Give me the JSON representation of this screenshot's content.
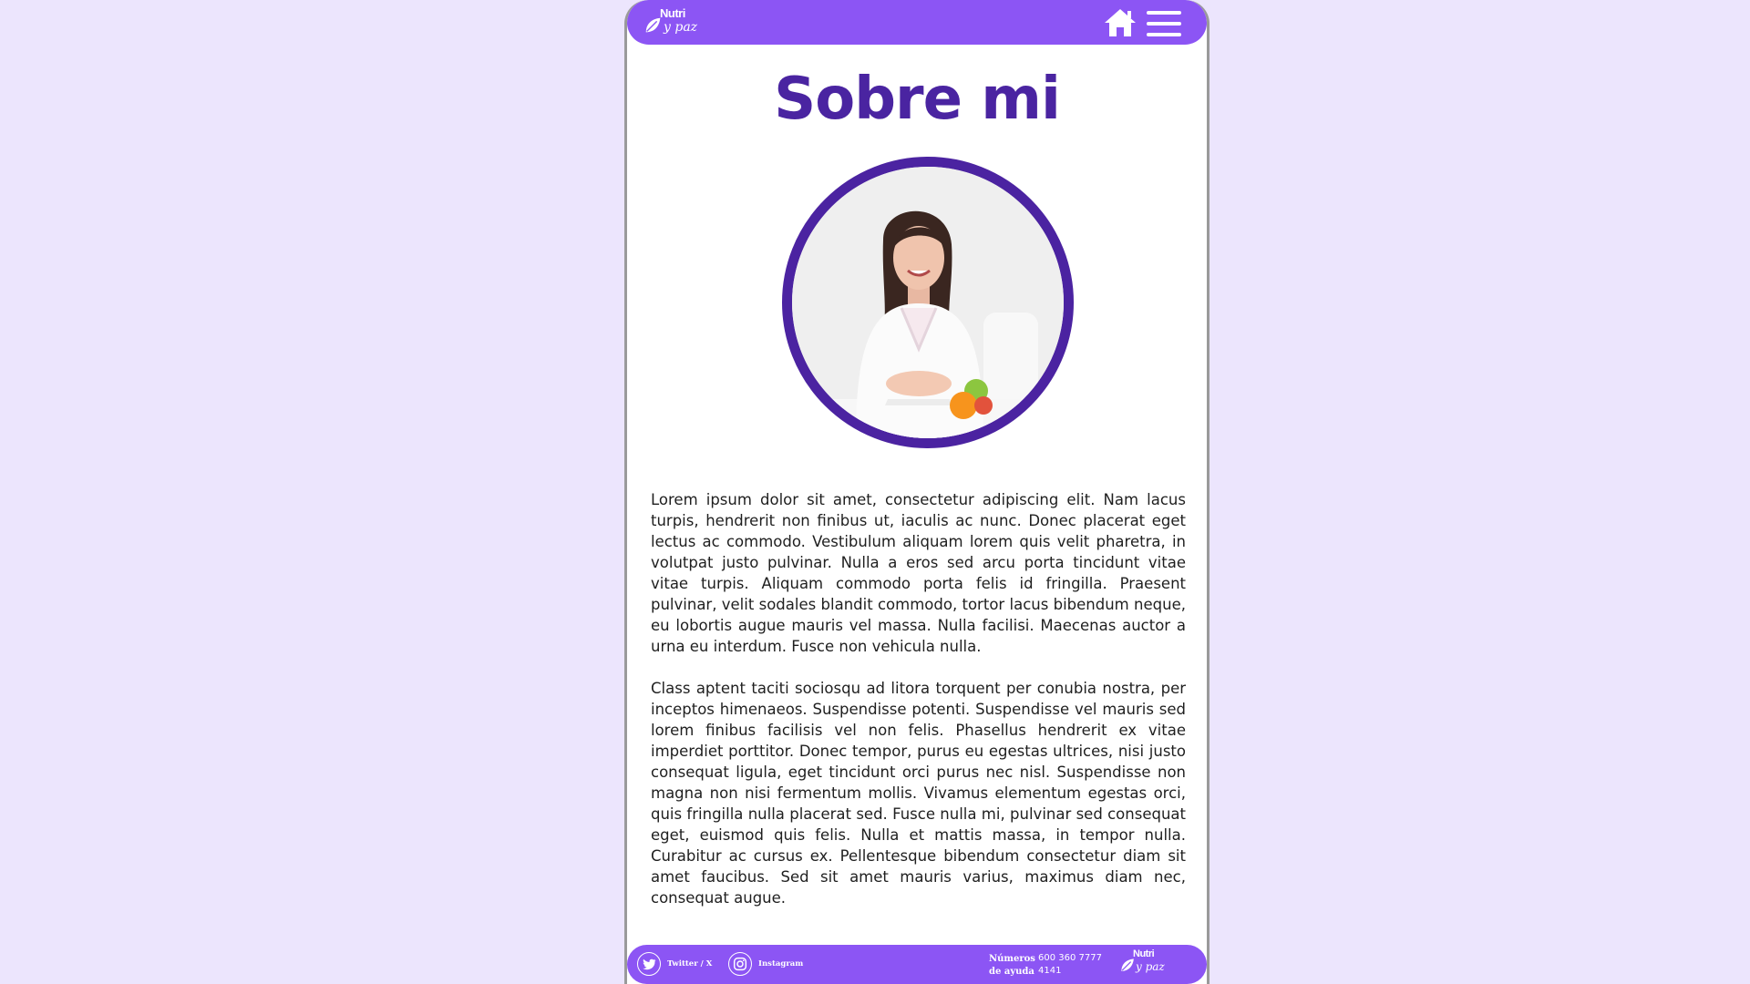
{
  "brand": {
    "line1": "Nutri",
    "line2": "y paz"
  },
  "header": {
    "home_icon": "home-icon",
    "menu_icon": "hamburger-menu-icon"
  },
  "page": {
    "title": "Sobre mi",
    "portrait_alt": "portrait-photo"
  },
  "content": {
    "paragraphs": [
      "Lorem ipsum dolor sit amet, consectetur adipiscing elit. Nam lacus turpis, hendrerit non finibus ut, iaculis ac nunc. Donec placerat eget lectus ac commodo. Vestibulum aliquam lorem quis velit pharetra, in volutpat justo pulvinar. Nulla a eros sed arcu porta tincidunt vitae vitae turpis. Aliquam commodo porta felis id fringilla. Praesent pulvinar, velit sodales blandit commodo, tortor lacus bibendum neque, eu lobortis augue mauris vel massa. Nulla facilisi. Maecenas auctor a urna eu interdum. Fusce non vehicula nulla.",
      "Class aptent taciti sociosqu ad litora torquent per conubia nostra, per inceptos himenaeos. Suspendisse potenti. Suspendisse vel mauris sed lorem finibus facilisis vel non felis. Phasellus hendrerit ex vitae imperdiet porttitor. Donec tempor, purus eu egestas ultrices, nisi justo consequat ligula, eget tincidunt orci purus nec nisl. Suspendisse non magna non nisi fermentum mollis. Vivamus elementum egestas orci, quis fringilla nulla placerat sed. Fusce nulla mi, pulvinar sed consequat eget, euismod quis felis. Nulla et mattis massa, in tempor nulla. Curabitur ac cursus ex. Pellentesque bibendum consectetur diam sit amet faucibus. Sed sit amet mauris varius, maximus diam nec, consequat augue."
    ]
  },
  "footer": {
    "twitter_label": "Twitter / X",
    "instagram_label": "Instagram",
    "help_label": "Números de ayuda",
    "help_number": "600 360 7777 4141"
  },
  "colors": {
    "background": "#ece5fd",
    "bar": "#8c55f4",
    "title": "#4a24a1",
    "portrait_ring": "#4b23a1"
  }
}
